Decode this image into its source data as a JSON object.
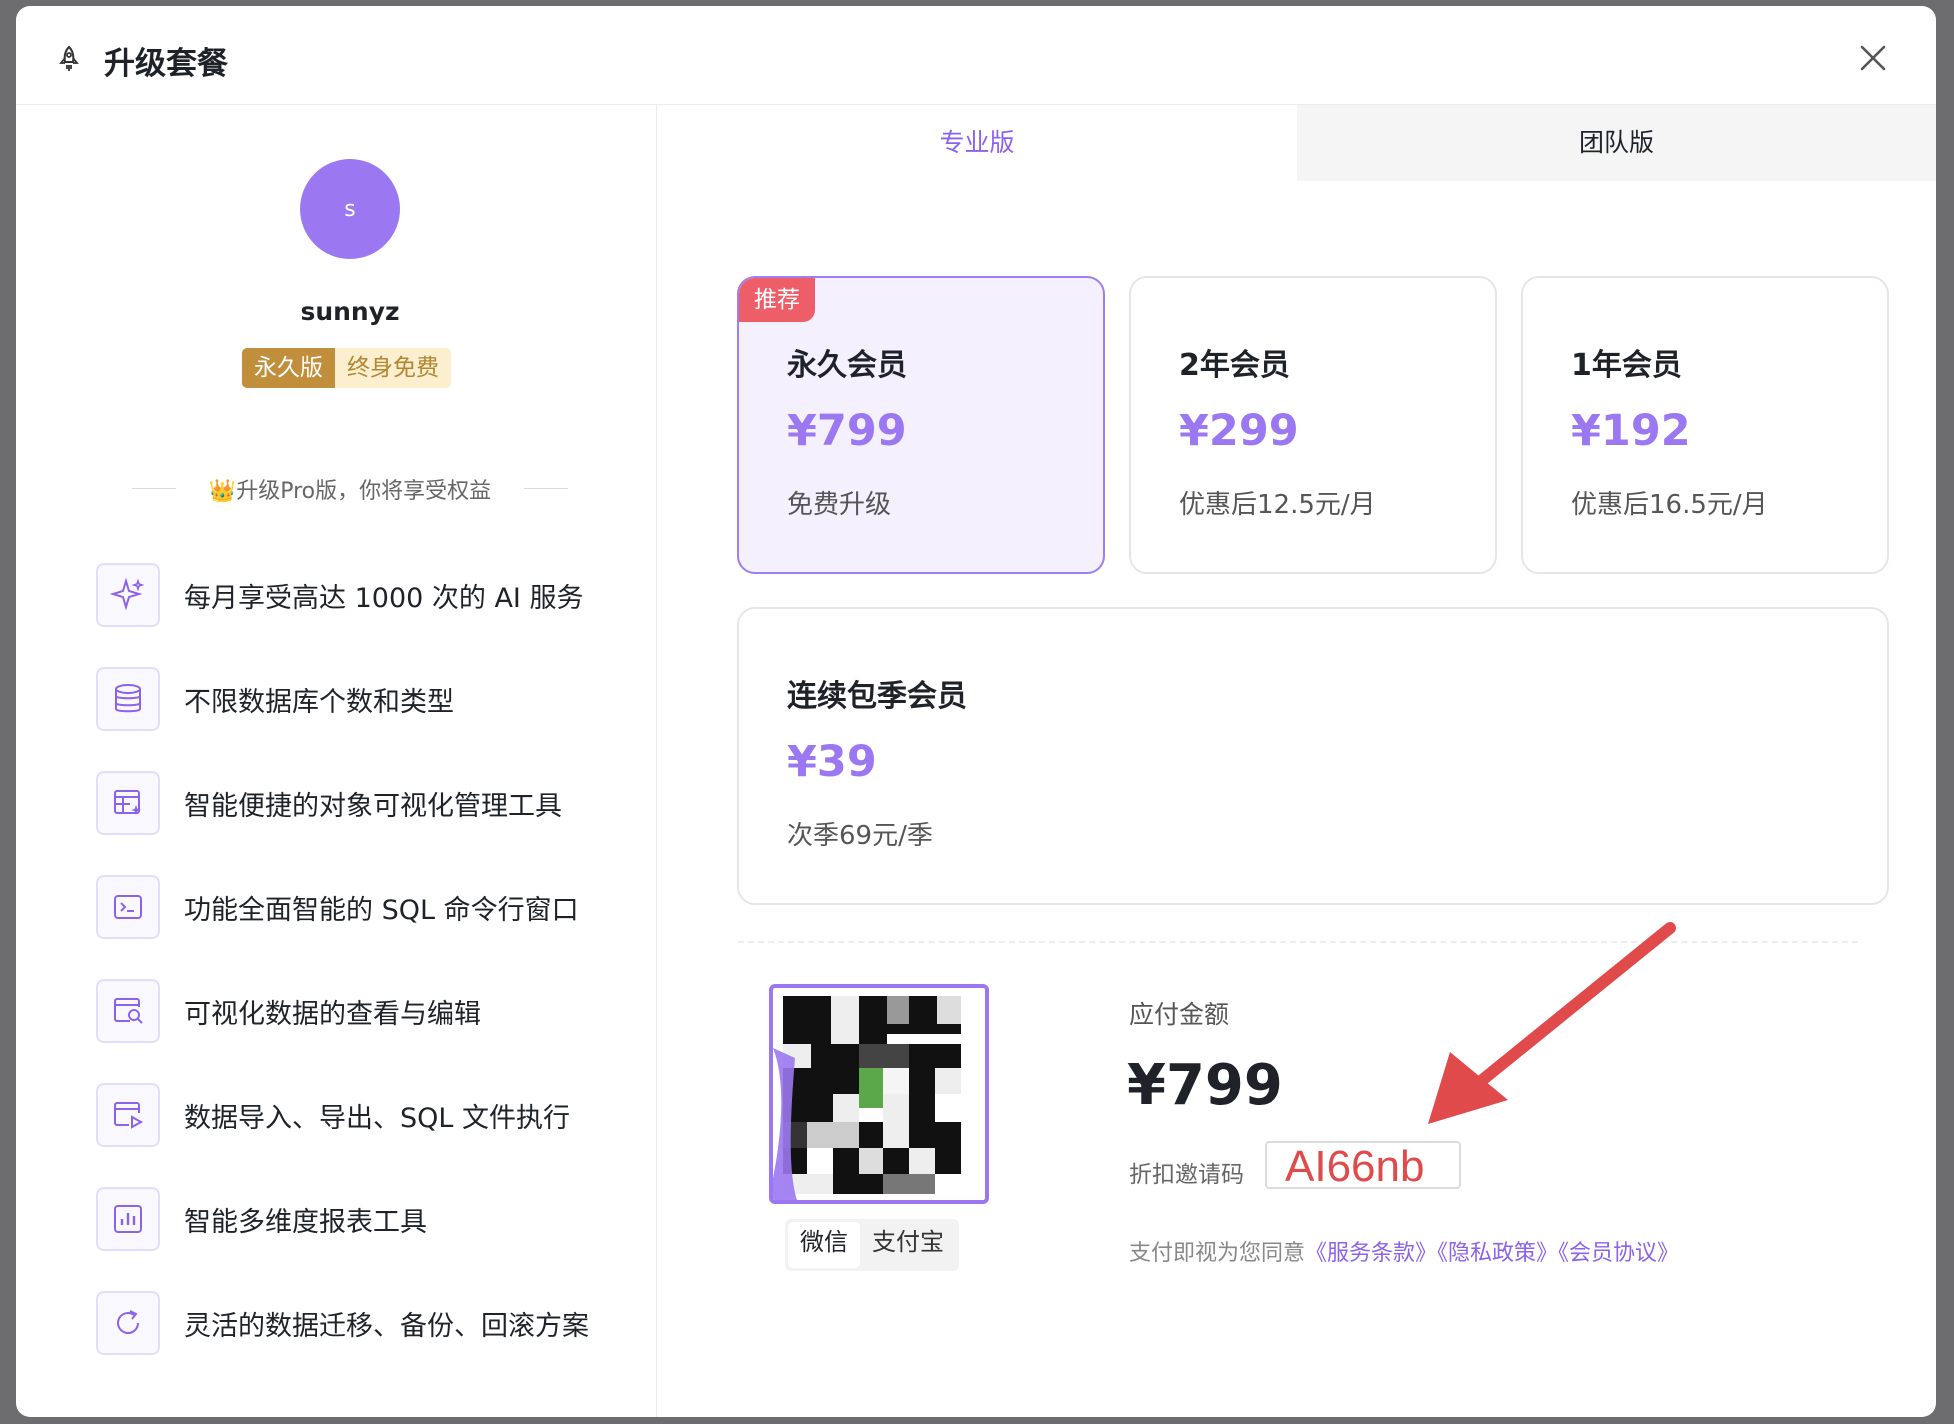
{
  "header": {
    "title": "升级套餐",
    "close_icon": "close-icon",
    "title_icon": "rocket-icon"
  },
  "profile": {
    "avatar_letter": "s",
    "username": "sunnyz",
    "badge_plan": "永久版",
    "badge_status": "终身免费"
  },
  "benefits": {
    "heading": "👑升级Pro版，你将享受权益",
    "items": [
      {
        "icon": "sparkle-icon",
        "label": "每月享受高达 1000 次的 AI 服务"
      },
      {
        "icon": "database-icon",
        "label": "不限数据库个数和类型"
      },
      {
        "icon": "table-edit-icon",
        "label": "智能便捷的对象可视化管理工具"
      },
      {
        "icon": "terminal-icon",
        "label": "功能全面智能的 SQL 命令行窗口"
      },
      {
        "icon": "data-search-icon",
        "label": "可视化数据的查看与编辑"
      },
      {
        "icon": "import-export-icon",
        "label": "数据导入、导出、SQL 文件执行"
      },
      {
        "icon": "bar-chart-icon",
        "label": "智能多维度报表工具"
      },
      {
        "icon": "refresh-icon",
        "label": "灵活的数据迁移、备份、回滚方案"
      }
    ]
  },
  "tabs": {
    "pro": "专业版",
    "team": "团队版",
    "active": "pro"
  },
  "plans": [
    {
      "name": "永久会员",
      "price": "¥799",
      "note": "免费升级",
      "tag": "推荐",
      "selected": true
    },
    {
      "name": "2年会员",
      "price": "¥299",
      "note": "优惠后12.5元/月",
      "selected": false
    },
    {
      "name": "1年会员",
      "price": "¥192",
      "note": "优惠后16.5元/月",
      "selected": false
    },
    {
      "name": "连续包季会员",
      "price": "¥39",
      "note": "次季69元/季",
      "selected": false
    }
  ],
  "payment": {
    "methods": [
      "微信",
      "支付宝"
    ],
    "active_method": "微信",
    "amount_label": "应付金额",
    "amount": "¥799",
    "code_label": "折扣邀请码",
    "code_value": "AI66nb",
    "agree_prefix": "支付即视为您同意",
    "links": [
      "《服务条款》",
      "《隐私政策》",
      "《会员协议》"
    ]
  },
  "colors": {
    "accent": "#9b78f1",
    "tag_red": "#ee5e69",
    "arrow_red": "#e14a4b",
    "badge_gold": "#c18f3c"
  }
}
